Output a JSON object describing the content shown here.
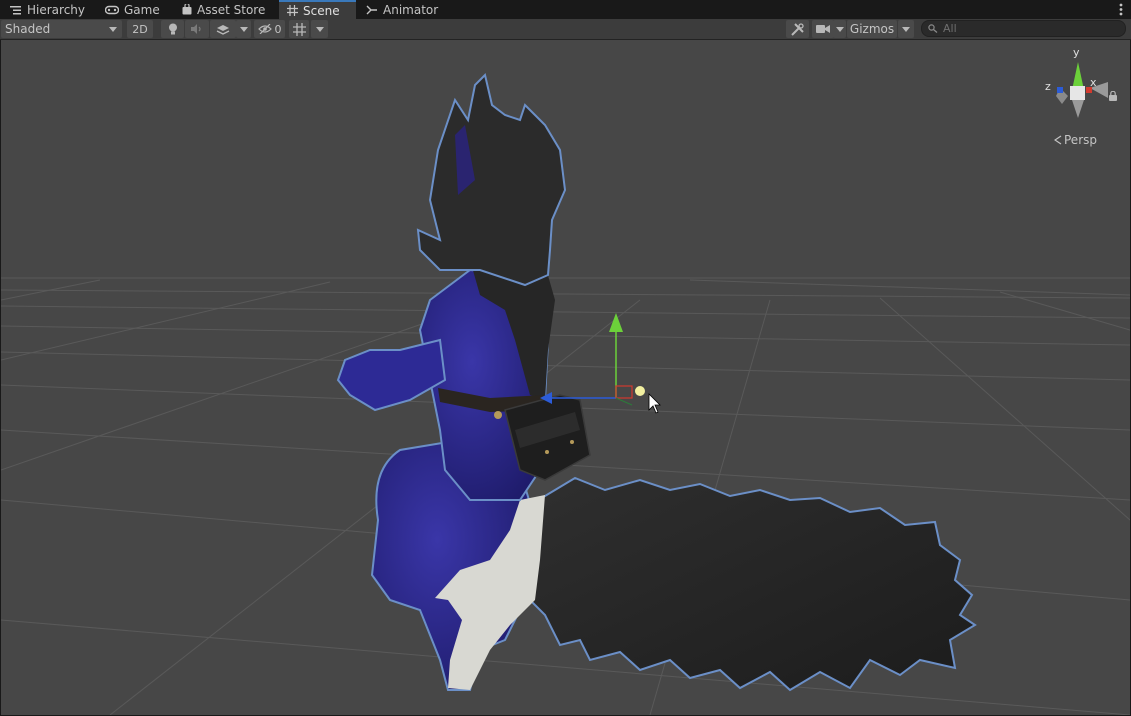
{
  "tabs": [
    {
      "label": "Hierarchy",
      "icon": "hierarchy-icon"
    },
    {
      "label": "Game",
      "icon": "gamepad-icon"
    },
    {
      "label": "Asset Store",
      "icon": "bag-icon"
    },
    {
      "label": "Scene",
      "icon": "grid-icon",
      "active": true
    },
    {
      "label": "Animator",
      "icon": "animator-icon"
    }
  ],
  "toolbar": {
    "shading_mode": "Shaded",
    "mode_2d": "2D",
    "hidden_count": "0",
    "gizmos_label": "Gizmos",
    "search_placeholder": "All"
  },
  "scene_gizmo": {
    "axis_y": "y",
    "axis_x": "x",
    "axis_z": "z",
    "projection": "Persp"
  },
  "colors": {
    "accent": "#3a79bb",
    "viewport_bg": "#474747",
    "toolbar_bg": "#3c3c3c",
    "gizmo_x": "#d23a2e",
    "gizmo_y": "#6cd13a",
    "gizmo_z": "#2c5cd8",
    "selection_outline": "#5b7fb4"
  }
}
